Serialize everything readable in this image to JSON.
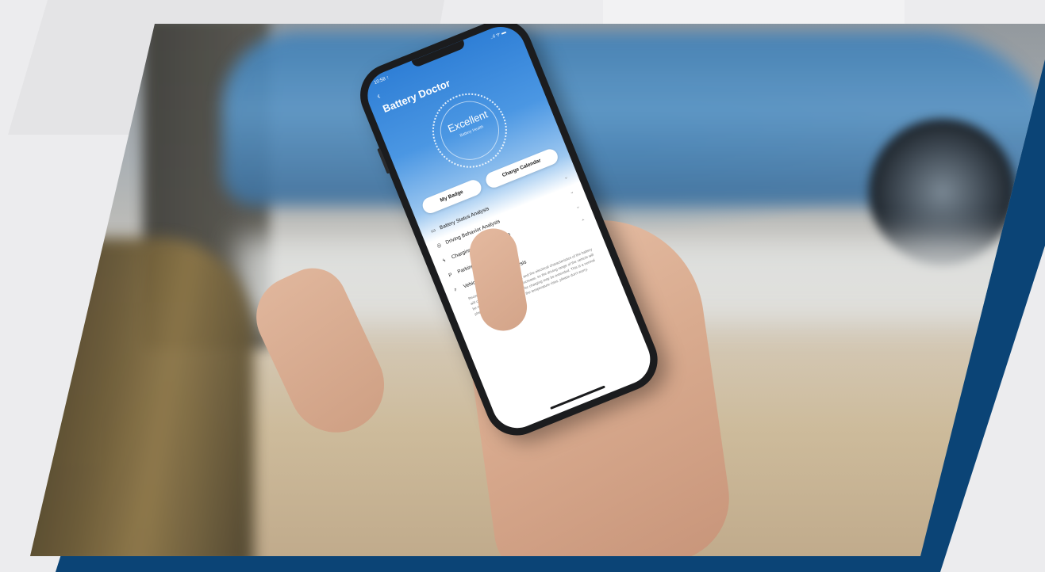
{
  "phone": {
    "status": {
      "time": "10:58 ↑",
      "icons": "..ıl ᯤ ▬"
    },
    "back_glyph": "‹",
    "title": "Battery Doctor",
    "gauge": {
      "rating": "Excellent",
      "subtitle": "Battery Health"
    },
    "buttons": {
      "my_badge": "My Badge",
      "charge_calendar": "Charge Calendar"
    },
    "sections": [
      {
        "label": "Battery Status Analysis",
        "icon": "battery-icon",
        "glyph": "▭",
        "chevron": "⌄"
      },
      {
        "label": "Driving Behavior Analysis",
        "icon": "steering-wheel-icon",
        "glyph": "◎",
        "chevron": "⌄"
      },
      {
        "label": "Charging Behavior Analysis",
        "icon": "lightning-icon",
        "glyph": "ϟ",
        "chevron": "⌄"
      },
      {
        "label": "Parking Behavior Analysis",
        "icon": "parking-flag-icon",
        "glyph": "P",
        "chevron": "⌃"
      },
      {
        "label": "Vehicle Environment Analysis",
        "icon": "thermometer-icon",
        "glyph": "ᵖ",
        "chevron": ""
      }
    ],
    "environment_description": "Recently the temperature is too low, and the electrical characteristics of the battery will cause its internal resistance to increase, so the driving range of the vehicle will be reduced, and the time required for charging may be extended. This is a normal phenomenon, it will recover when the temperature rises, please don't worry."
  },
  "colors": {
    "navy_frame": "#0b4476",
    "screen_blue": "#2f7fd6",
    "car_blue": "#5a96c7"
  }
}
